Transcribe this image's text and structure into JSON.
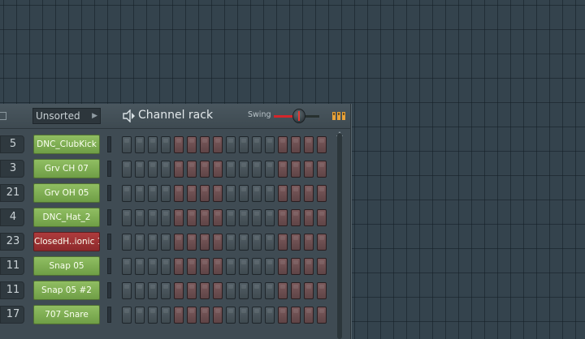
{
  "channel_rack": {
    "filter_label": "Unsorted",
    "title": "Channel rack",
    "swing_label": "Swing",
    "swing_level_percent": 55,
    "accent_color": "#d3262b",
    "icons": [
      "folder-icon",
      "speaker-icon",
      "graph-editor-icon",
      "scroll-up-icon"
    ]
  },
  "channels": [
    {
      "route": "5",
      "name": "DNC_ClubKick",
      "color": "green"
    },
    {
      "route": "3",
      "name": "Grv CH 07",
      "color": "green"
    },
    {
      "route": "21",
      "name": "Grv OH 05",
      "color": "green"
    },
    {
      "route": "4",
      "name": "DNC_Hat_2",
      "color": "green"
    },
    {
      "route": "23",
      "name": "ClosedH..ionic 1",
      "color": "red"
    },
    {
      "route": "11",
      "name": "Snap 05",
      "color": "green"
    },
    {
      "route": "11",
      "name": "Snap 05 #2",
      "color": "green"
    },
    {
      "route": "17",
      "name": "707 Snare",
      "color": "green"
    }
  ],
  "step_pattern": [
    "dark",
    "dark",
    "dark",
    "dark",
    "red",
    "red",
    "red",
    "red",
    "dark",
    "dark",
    "dark",
    "dark",
    "red",
    "red",
    "red",
    "red"
  ]
}
